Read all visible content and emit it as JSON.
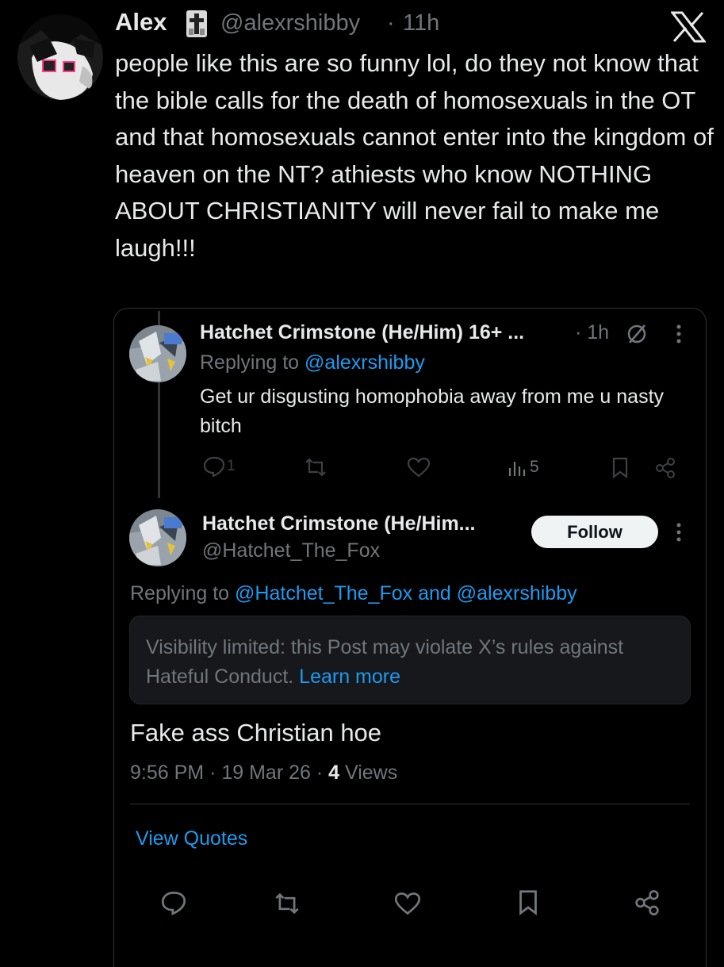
{
  "parent": {
    "name": "Alex",
    "handle": "@alexrshibby",
    "dot": "·",
    "time": "11h",
    "text": "people like this are so funny lol, do they not know that the bible calls for the death of homosexuals in the OT and that homosexuals cannot enter into the kingdom of heaven on the NT? athiests who know NOTHING ABOUT CHRISTIANITY will never fail to make me laugh!!!"
  },
  "quoted": {
    "name": "Hatchet Crimstone (He/Him) 16+ ...",
    "time": "· 1h",
    "replying_prefix": "Replying to",
    "replying_handle": "@alexrshibby",
    "text": "Get ur disgusting homophobia away from me u nasty bitch",
    "reply_count": "1",
    "views": "5"
  },
  "reply": {
    "name": "Hatchet Crimstone (He/Him...",
    "handle": "@Hatchet_The_Fox",
    "follow_label": "Follow",
    "replying_prefix": "Replying to",
    "replying_handle1": "@Hatchet_The_Fox",
    "and": "and",
    "replying_handle2": "@alexrshibby",
    "notice_text": "Visibility limited: this Post may violate X’s rules against Hateful Conduct.",
    "notice_link": "Learn more",
    "text": "Fake ass Christian hoe",
    "time": "9:56 PM",
    "date": "19 Mar 26",
    "views_count": "4",
    "views_label": "Views",
    "sep": "·"
  },
  "view_quotes": "View Quotes",
  "icons": [
    "verified-cross-badge-icon",
    "x-logo-icon",
    "more-icon",
    "reply-icon",
    "repost-icon",
    "like-icon",
    "views-icon",
    "bookmark-icon",
    "share-icon",
    "slash-circle-icon"
  ],
  "colors": {
    "background": "#000000",
    "text": "#e7e9ea",
    "muted": "#71767b",
    "accent": "#1d9bf0",
    "card": "#16181c"
  }
}
